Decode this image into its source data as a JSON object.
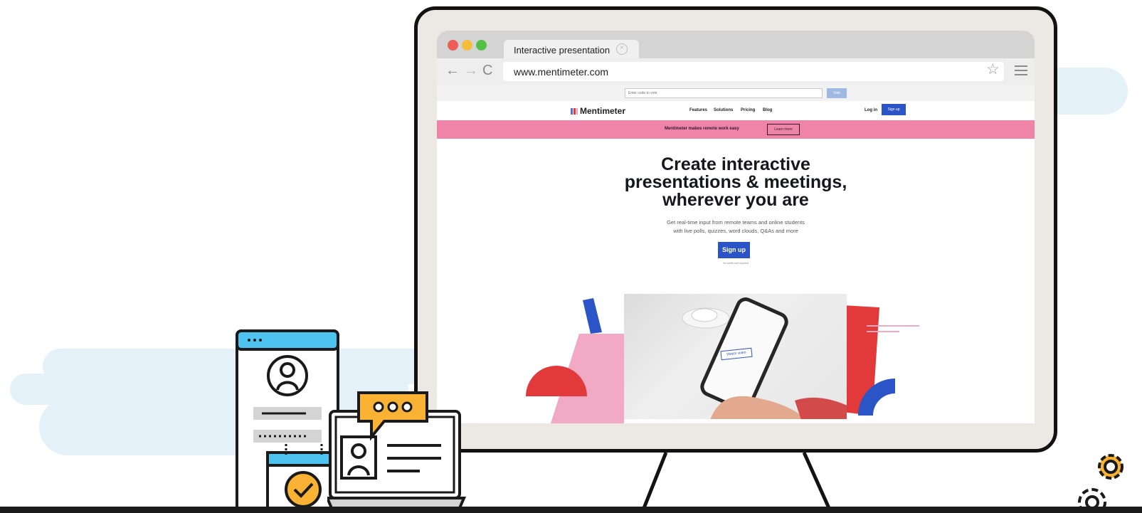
{
  "browser": {
    "tab_title": "Interactive presentation",
    "tab_close": "×",
    "url": "www.mentimeter.com",
    "nav_back": "←",
    "nav_forward": "→",
    "nav_reload": "C",
    "bookmark_star": "☆",
    "window_dots": [
      "#ed5e57",
      "#f4be3a",
      "#53c146"
    ]
  },
  "site": {
    "vote_placeholder": "Enter code to vote",
    "vote_button": "Vote",
    "logo": "Mentimeter",
    "nav": [
      "Features",
      "Solutions",
      "Pricing",
      "Blog"
    ],
    "login": "Log in",
    "signup_small": "Sign up",
    "promo_text": "Mentimeter makes remote work easy",
    "promo_button": "Learn more",
    "hero_lines": [
      "Create interactive",
      "presentations & meetings,",
      "wherever you are"
    ],
    "subtitle_lines": [
      "Get real-time input from remote teams and online students",
      "with live polls, quizzes, word clouds, Q&As and more"
    ],
    "cta": "Sign up",
    "cta_note": "No credit card required",
    "watch_video": "Watch video"
  },
  "colors": {
    "brand_blue": "#2b55c6",
    "promo_pink": "#ee85a9",
    "accent_red": "#e23a3a",
    "illustration_blue": "#4fc3ef",
    "illustration_yellow": "#f9b233"
  },
  "icons": [
    "user-profile-icon",
    "calendar-check-icon",
    "chat-bubble-icon",
    "id-card-icon",
    "laptop-icon",
    "gears-icon"
  ]
}
